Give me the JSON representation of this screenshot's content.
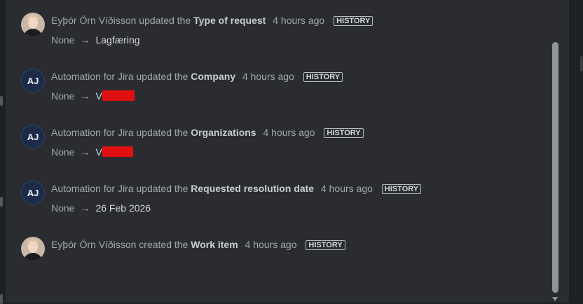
{
  "history_label": "HISTORY",
  "entries": [
    {
      "avatar": "photo",
      "actor": "Eyþór Örn Víðisson",
      "action": "updated the",
      "field": "Type of request",
      "time": "4 hours ago",
      "from": "None",
      "to": "Lagfæring"
    },
    {
      "avatar": "AJ",
      "actor": "Automation for Jira",
      "action": "updated the",
      "field": "Company",
      "time": "4 hours ago",
      "from": "None",
      "to": "V"
    },
    {
      "avatar": "AJ",
      "actor": "Automation for Jira",
      "action": "updated the",
      "field": "Organizations",
      "time": "4 hours ago",
      "from": "None",
      "to": "V"
    },
    {
      "avatar": "AJ",
      "actor": "Automation for Jira",
      "action": "updated the",
      "field": "Requested resolution date",
      "time": "4 hours ago",
      "from": "None",
      "to": "26 Feb 2026"
    },
    {
      "avatar": "photo",
      "actor": "Eyþór Örn Víðisson",
      "action": "created the",
      "field": "Work item",
      "time": "4 hours ago"
    }
  ],
  "icons": {
    "arrow": "→"
  }
}
